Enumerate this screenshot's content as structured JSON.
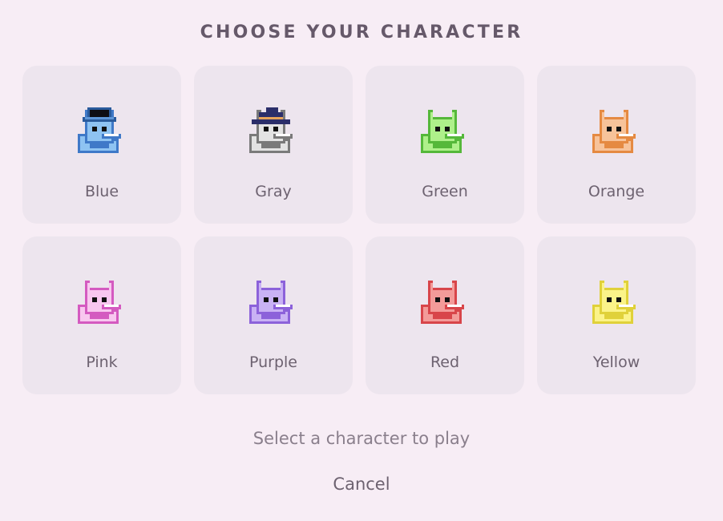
{
  "title": "CHOOSE YOUR CHARACTER",
  "characters": [
    {
      "label": "Blue",
      "icon": "blue-cat-tophat-icon",
      "color": "#8ec3f2",
      "dark": "#3f79c8",
      "accessory": "tophat"
    },
    {
      "label": "Gray",
      "icon": "gray-cat-wizardhat-icon",
      "color": "#e3e3e3",
      "dark": "#7a7a7a",
      "accessory": "wizard"
    },
    {
      "label": "Green",
      "icon": "green-cat-icon",
      "color": "#aef08a",
      "dark": "#55b83a",
      "accessory": "none"
    },
    {
      "label": "Orange",
      "icon": "orange-cat-icon",
      "color": "#f7c39a",
      "dark": "#e58a42",
      "accessory": "none"
    },
    {
      "label": "Pink",
      "icon": "pink-cat-icon",
      "color": "#f8c7ef",
      "dark": "#d45ac0",
      "accessory": "none"
    },
    {
      "label": "Purple",
      "icon": "purple-cat-icon",
      "color": "#c9b2f4",
      "dark": "#8c62da",
      "accessory": "none"
    },
    {
      "label": "Red",
      "icon": "red-cat-icon",
      "color": "#f39b99",
      "dark": "#d8454a",
      "accessory": "none"
    },
    {
      "label": "Yellow",
      "icon": "yellow-cat-icon",
      "color": "#fbf389",
      "dark": "#e0d13a",
      "accessory": "none"
    }
  ],
  "hint": "Select a character to play",
  "cancel_label": "Cancel"
}
